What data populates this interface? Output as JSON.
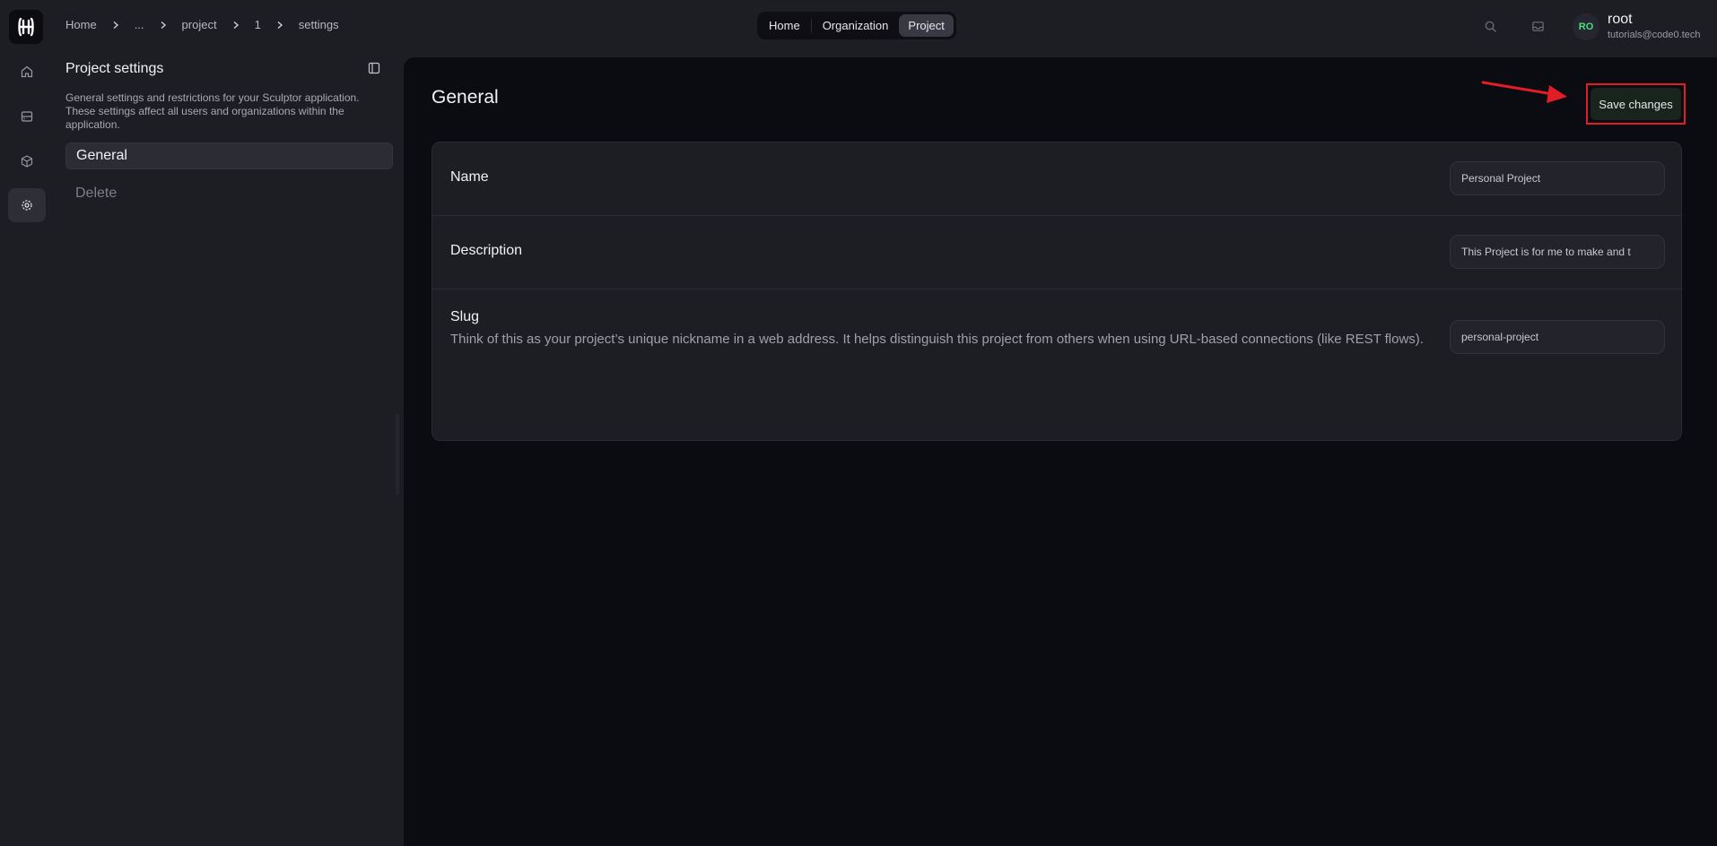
{
  "breadcrumb": [
    "Home",
    "...",
    "project",
    "1",
    "settings"
  ],
  "scope_tabs": [
    {
      "label": "Home",
      "active": false
    },
    {
      "label": "Organization",
      "active": false
    },
    {
      "label": "Project",
      "active": true
    }
  ],
  "user": {
    "initials": "RO",
    "name": "root",
    "email": "tutorials@code0.tech"
  },
  "sidebar": {
    "title": "Project settings",
    "description": "General settings and restrictions for your Sculptor application. These settings affect all users and organizations within the application.",
    "items": [
      {
        "label": "General",
        "active": true
      },
      {
        "label": "Delete",
        "active": false
      }
    ]
  },
  "main": {
    "title": "General",
    "save_label": "Save changes"
  },
  "fields": {
    "name": {
      "label": "Name",
      "value": "Personal Project"
    },
    "description": {
      "label": "Description",
      "value": "This Project is for me to make and t"
    },
    "slug": {
      "label": "Slug",
      "help": "Think of this as your project’s unique nickname in a web address. It helps distinguish this project from others when using URL-based connections (like REST flows).",
      "value": "personal-project"
    }
  },
  "colors": {
    "accent_green": "#4ade80",
    "annotation_red": "#e11d26"
  },
  "icons": {
    "rail": [
      "home-icon",
      "server-icon",
      "cube-icon",
      "gear-icon"
    ],
    "top": [
      "search-icon",
      "inbox-icon"
    ]
  }
}
